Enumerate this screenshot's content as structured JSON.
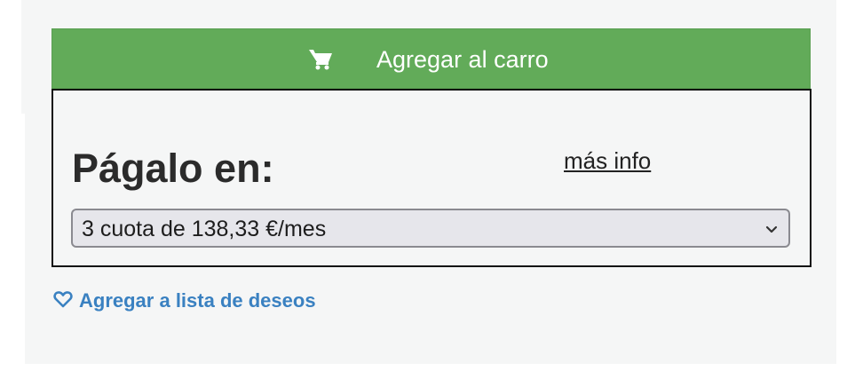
{
  "cart": {
    "label": "Agregar al carro",
    "icon": "shopping-cart-icon",
    "background_color": "#62ab59"
  },
  "payment": {
    "title": "Págalo en:",
    "more_info_label": "más info",
    "installments_selected": "3 cuota de 138,33 €/mes",
    "dropdown_icon": "chevron-down-icon"
  },
  "wishlist": {
    "label": "Agregar a lista de deseos",
    "icon": "heart-outline-icon",
    "color": "#3a81c1"
  }
}
